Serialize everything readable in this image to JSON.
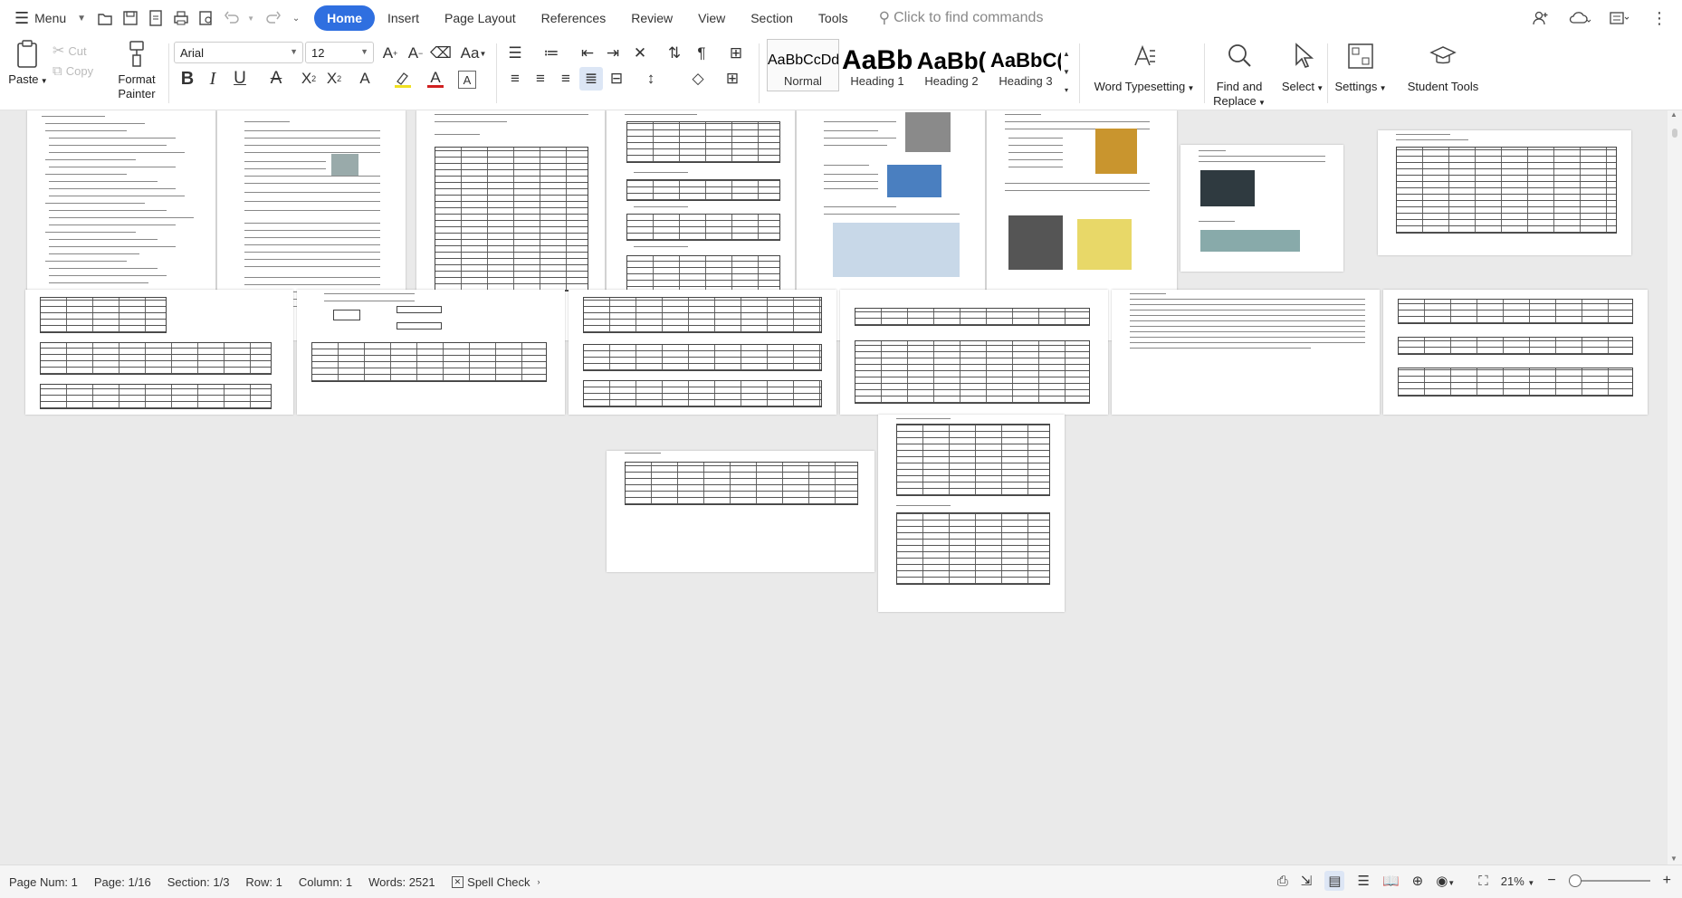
{
  "menubar": {
    "menu_label": "Menu",
    "tabs": [
      {
        "label": "Home",
        "active": true
      },
      {
        "label": "Insert"
      },
      {
        "label": "Page Layout"
      },
      {
        "label": "References"
      },
      {
        "label": "Review"
      },
      {
        "label": "View"
      },
      {
        "label": "Section"
      },
      {
        "label": "Tools"
      }
    ],
    "search_placeholder": "Click to find commands"
  },
  "ribbon": {
    "paste": "Paste",
    "cut": "Cut",
    "copy": "Copy",
    "format_painter_1": "Format",
    "format_painter_2": "Painter",
    "font_name": "Arial",
    "font_size": "12",
    "styles": [
      {
        "preview": "AaBbCcDd",
        "name": "Normal"
      },
      {
        "preview": "AaBb",
        "name": "Heading 1"
      },
      {
        "preview": "AaBb(",
        "name": "Heading 2"
      },
      {
        "preview": "AaBbC(",
        "name": "Heading 3"
      }
    ],
    "word_typesetting": "Word Typesetting",
    "find_replace_1": "Find and",
    "find_replace_2": "Replace",
    "select": "Select",
    "settings": "Settings",
    "student_tools": "Student Tools"
  },
  "statusbar": {
    "page_num": "Page Num: 1",
    "page": "Page: 1/16",
    "section": "Section: 1/3",
    "row": "Row: 1",
    "column": "Column: 1",
    "words": "Words: 2521",
    "spell_check": "Spell Check",
    "zoom": "21%"
  },
  "colors": {
    "accent": "#2f6fe0",
    "font_color_bar": "#d02020",
    "highlight_bar": "#f0e020"
  }
}
